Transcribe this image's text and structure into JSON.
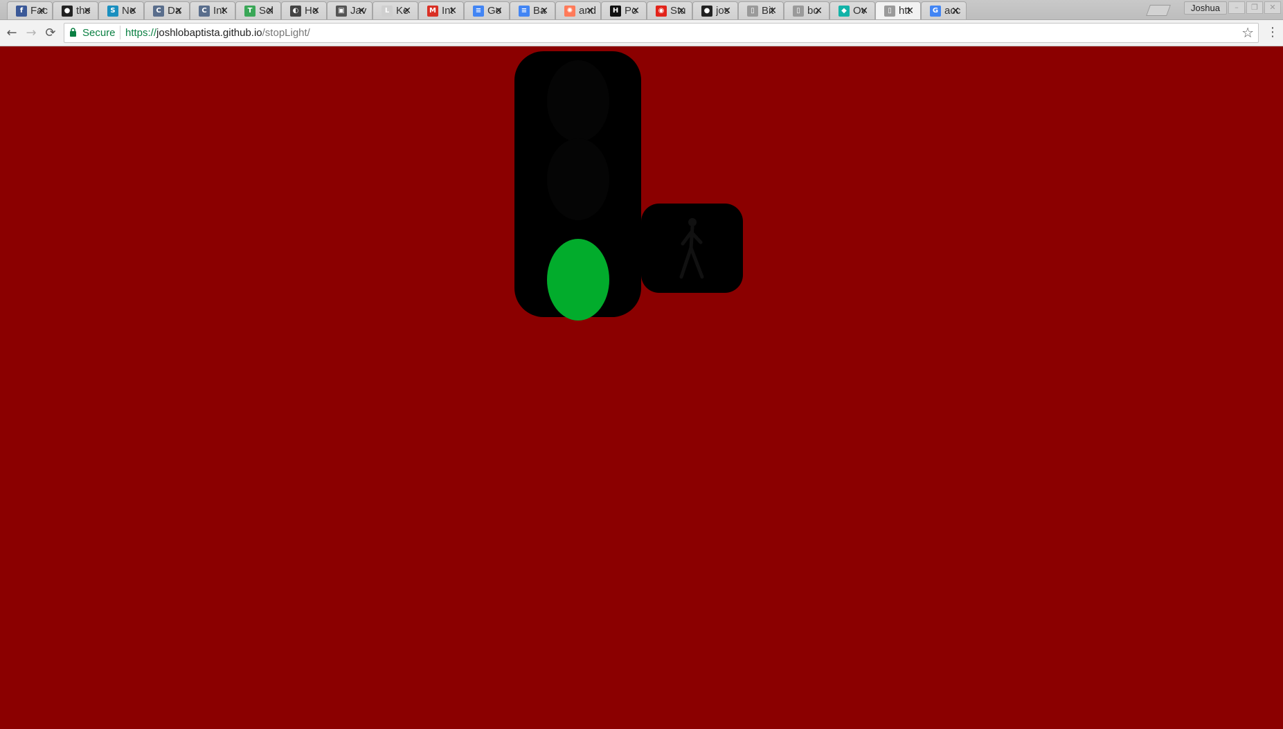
{
  "browser": {
    "tabs": [
      {
        "title": "Fac",
        "favicon": "facebook-icon",
        "color": "#3b5998",
        "glyph": "f"
      },
      {
        "title": "the",
        "favicon": "github-icon",
        "color": "#222222",
        "glyph": "●"
      },
      {
        "title": "Ne",
        "favicon": "s-circle-icon",
        "color": "#1a8fbf",
        "glyph": "S"
      },
      {
        "title": "Da",
        "favicon": "c-logo-icon",
        "color": "#5a6e8c",
        "glyph": "C"
      },
      {
        "title": "Int",
        "favicon": "c-logo-icon",
        "color": "#5a6e8c",
        "glyph": "C"
      },
      {
        "title": "Scl",
        "favicon": "tech-logo-icon",
        "color": "#3aa757",
        "glyph": "T"
      },
      {
        "title": "Ho",
        "favicon": "ring-logo-icon",
        "color": "#444444",
        "glyph": "◐"
      },
      {
        "title": "Jav",
        "favicon": "image-icon",
        "color": "#555555",
        "glyph": "▣"
      },
      {
        "title": "Ke",
        "favicon": "l-logo-icon",
        "color": "#cfcfcf",
        "glyph": "L"
      },
      {
        "title": "Int",
        "favicon": "gmail-icon",
        "color": "#d93025",
        "glyph": "M"
      },
      {
        "title": "Go",
        "favicon": "google-docs-icon",
        "color": "#4285f4",
        "glyph": "≡"
      },
      {
        "title": "Ba",
        "favicon": "google-docs-icon",
        "color": "#4285f4",
        "glyph": "≡"
      },
      {
        "title": "and",
        "favicon": "hubspot-icon",
        "color": "#ff7a59",
        "glyph": "✺"
      },
      {
        "title": "Po",
        "favicon": "hackerrank-icon",
        "color": "#111111",
        "glyph": "H"
      },
      {
        "title": "Stu",
        "favicon": "red-chat-icon",
        "color": "#e2231a",
        "glyph": "◉"
      },
      {
        "title": "jos",
        "favicon": "github-icon",
        "color": "#222222",
        "glyph": "●"
      },
      {
        "title": "Bit",
        "favicon": "page-icon",
        "color": "#9a9a9a",
        "glyph": "▯"
      },
      {
        "title": "bo",
        "favicon": "page-icon",
        "color": "#9a9a9a",
        "glyph": "▯"
      },
      {
        "title": "Ov",
        "favicon": "diamond-icon",
        "color": "#12b3a8",
        "glyph": "◆"
      },
      {
        "title": "htt",
        "favicon": "page-icon",
        "color": "#9a9a9a",
        "glyph": "▯",
        "active": true
      },
      {
        "title": "acc",
        "favicon": "google-icon",
        "color": "#4285f4",
        "glyph": "G"
      }
    ],
    "close_glyph": "✕",
    "profile_name": "Joshua",
    "nav": {
      "back": "←",
      "forward": "→",
      "reload": "⟳",
      "star": "☆",
      "menu": "⋮"
    },
    "security_label": "Secure",
    "url_scheme": "https://",
    "url_host": "joshlobaptista.github.io",
    "url_path": "/stopLight/"
  },
  "page": {
    "background_color": "#8b0000",
    "traffic_light": {
      "housing_color": "#000000",
      "active_lamp": "green",
      "lamps": {
        "red": "#050505",
        "yellow": "#050505",
        "green": "#02ac2c"
      }
    },
    "pedestrian_signal": {
      "housing_color": "#000000",
      "figure_icon": "walking-person-icon",
      "figure_color": "#111111"
    }
  }
}
